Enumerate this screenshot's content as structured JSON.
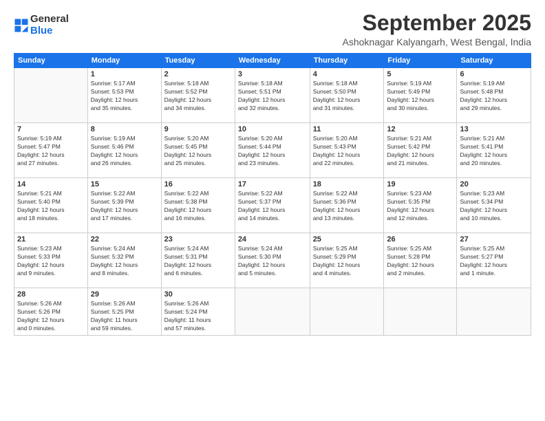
{
  "logo": {
    "line1": "General",
    "line2": "Blue"
  },
  "title": "September 2025",
  "location": "Ashoknagar Kalyangarh, West Bengal, India",
  "days_of_week": [
    "Sunday",
    "Monday",
    "Tuesday",
    "Wednesday",
    "Thursday",
    "Friday",
    "Saturday"
  ],
  "weeks": [
    [
      {
        "day": "",
        "info": ""
      },
      {
        "day": "1",
        "info": "Sunrise: 5:17 AM\nSunset: 5:53 PM\nDaylight: 12 hours\nand 35 minutes."
      },
      {
        "day": "2",
        "info": "Sunrise: 5:18 AM\nSunset: 5:52 PM\nDaylight: 12 hours\nand 34 minutes."
      },
      {
        "day": "3",
        "info": "Sunrise: 5:18 AM\nSunset: 5:51 PM\nDaylight: 12 hours\nand 32 minutes."
      },
      {
        "day": "4",
        "info": "Sunrise: 5:18 AM\nSunset: 5:50 PM\nDaylight: 12 hours\nand 31 minutes."
      },
      {
        "day": "5",
        "info": "Sunrise: 5:19 AM\nSunset: 5:49 PM\nDaylight: 12 hours\nand 30 minutes."
      },
      {
        "day": "6",
        "info": "Sunrise: 5:19 AM\nSunset: 5:48 PM\nDaylight: 12 hours\nand 29 minutes."
      }
    ],
    [
      {
        "day": "7",
        "info": "Sunrise: 5:19 AM\nSunset: 5:47 PM\nDaylight: 12 hours\nand 27 minutes."
      },
      {
        "day": "8",
        "info": "Sunrise: 5:19 AM\nSunset: 5:46 PM\nDaylight: 12 hours\nand 26 minutes."
      },
      {
        "day": "9",
        "info": "Sunrise: 5:20 AM\nSunset: 5:45 PM\nDaylight: 12 hours\nand 25 minutes."
      },
      {
        "day": "10",
        "info": "Sunrise: 5:20 AM\nSunset: 5:44 PM\nDaylight: 12 hours\nand 23 minutes."
      },
      {
        "day": "11",
        "info": "Sunrise: 5:20 AM\nSunset: 5:43 PM\nDaylight: 12 hours\nand 22 minutes."
      },
      {
        "day": "12",
        "info": "Sunrise: 5:21 AM\nSunset: 5:42 PM\nDaylight: 12 hours\nand 21 minutes."
      },
      {
        "day": "13",
        "info": "Sunrise: 5:21 AM\nSunset: 5:41 PM\nDaylight: 12 hours\nand 20 minutes."
      }
    ],
    [
      {
        "day": "14",
        "info": "Sunrise: 5:21 AM\nSunset: 5:40 PM\nDaylight: 12 hours\nand 18 minutes."
      },
      {
        "day": "15",
        "info": "Sunrise: 5:22 AM\nSunset: 5:39 PM\nDaylight: 12 hours\nand 17 minutes."
      },
      {
        "day": "16",
        "info": "Sunrise: 5:22 AM\nSunset: 5:38 PM\nDaylight: 12 hours\nand 16 minutes."
      },
      {
        "day": "17",
        "info": "Sunrise: 5:22 AM\nSunset: 5:37 PM\nDaylight: 12 hours\nand 14 minutes."
      },
      {
        "day": "18",
        "info": "Sunrise: 5:22 AM\nSunset: 5:36 PM\nDaylight: 12 hours\nand 13 minutes."
      },
      {
        "day": "19",
        "info": "Sunrise: 5:23 AM\nSunset: 5:35 PM\nDaylight: 12 hours\nand 12 minutes."
      },
      {
        "day": "20",
        "info": "Sunrise: 5:23 AM\nSunset: 5:34 PM\nDaylight: 12 hours\nand 10 minutes."
      }
    ],
    [
      {
        "day": "21",
        "info": "Sunrise: 5:23 AM\nSunset: 5:33 PM\nDaylight: 12 hours\nand 9 minutes."
      },
      {
        "day": "22",
        "info": "Sunrise: 5:24 AM\nSunset: 5:32 PM\nDaylight: 12 hours\nand 8 minutes."
      },
      {
        "day": "23",
        "info": "Sunrise: 5:24 AM\nSunset: 5:31 PM\nDaylight: 12 hours\nand 6 minutes."
      },
      {
        "day": "24",
        "info": "Sunrise: 5:24 AM\nSunset: 5:30 PM\nDaylight: 12 hours\nand 5 minutes."
      },
      {
        "day": "25",
        "info": "Sunrise: 5:25 AM\nSunset: 5:29 PM\nDaylight: 12 hours\nand 4 minutes."
      },
      {
        "day": "26",
        "info": "Sunrise: 5:25 AM\nSunset: 5:28 PM\nDaylight: 12 hours\nand 2 minutes."
      },
      {
        "day": "27",
        "info": "Sunrise: 5:25 AM\nSunset: 5:27 PM\nDaylight: 12 hours\nand 1 minute."
      }
    ],
    [
      {
        "day": "28",
        "info": "Sunrise: 5:26 AM\nSunset: 5:26 PM\nDaylight: 12 hours\nand 0 minutes."
      },
      {
        "day": "29",
        "info": "Sunrise: 5:26 AM\nSunset: 5:25 PM\nDaylight: 11 hours\nand 59 minutes."
      },
      {
        "day": "30",
        "info": "Sunrise: 5:26 AM\nSunset: 5:24 PM\nDaylight: 11 hours\nand 57 minutes."
      },
      {
        "day": "",
        "info": ""
      },
      {
        "day": "",
        "info": ""
      },
      {
        "day": "",
        "info": ""
      },
      {
        "day": "",
        "info": ""
      }
    ]
  ]
}
